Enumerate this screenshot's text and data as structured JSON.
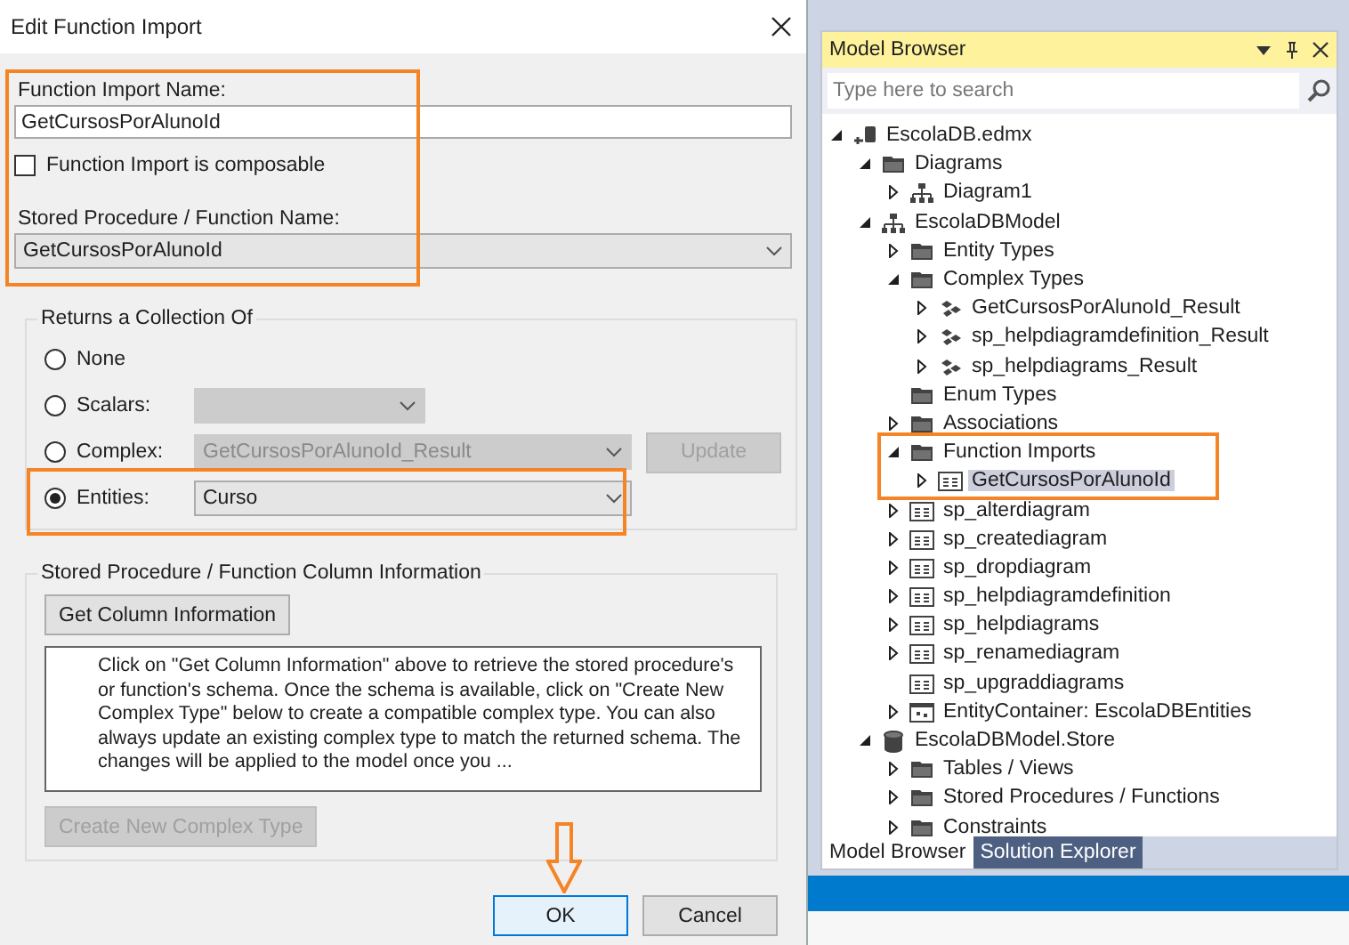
{
  "dialog": {
    "title": "Edit Function Import",
    "name_section": {
      "callout": true,
      "name_label": "Function Import Name:",
      "name_value": "GetCursosPorAlunoId",
      "composable": {
        "label": "Function Import is composable",
        "checked": false
      },
      "procedure_label": "Stored Procedure / Function Name:",
      "procedure_value": "GetCursosPorAlunoId"
    },
    "returns_group": {
      "title": "Returns a Collection Of",
      "options": [
        {
          "label": "None",
          "selected": false
        },
        {
          "label": "Scalars:",
          "selected": false,
          "dropdown": {
            "disabled": true
          }
        },
        {
          "label": "Complex:",
          "selected": false,
          "dropdown": {
            "value": "GetCursosPorAlunoId_Result",
            "disabled": true
          },
          "button": {
            "label": "Update",
            "disabled": true
          }
        },
        {
          "label": "Entities:",
          "selected": true,
          "callout": true,
          "dropdown": {
            "value": "Curso",
            "disabled": false
          }
        }
      ]
    },
    "column_group": {
      "title": "Stored Procedure / Function Column Information",
      "get_button": "Get Column Information",
      "info_text": "Click on \"Get Column Information\" above to retrieve the stored procedure's or function's schema. Once the schema is available, click on \"Create New Complex Type\" below to create a compatible complex type. You can also always update an existing complex type to match the returned schema. The changes will be applied to the model once you ...",
      "create_button": {
        "label": "Create New Complex Type",
        "disabled": true
      }
    },
    "buttons": [
      {
        "label": "OK",
        "pointed": true
      },
      {
        "label": "Cancel",
        "pointed": false
      }
    ]
  },
  "model_browser": {
    "title": "Model Browser",
    "search": {
      "placeholder": "Type here to search"
    },
    "tree": [
      {
        "label": "EscolaDB.edmx",
        "kind": "edmx",
        "expanded": true,
        "selected": false,
        "children": [
          {
            "label": "Diagrams",
            "kind": "folder",
            "expanded": true,
            "selected": false,
            "children": [
              {
                "label": "Diagram1",
                "kind": "diagram",
                "expanded": false,
                "selected": false
              }
            ]
          },
          {
            "label": "EscolaDBModel",
            "kind": "diagram",
            "expanded": true,
            "selected": false,
            "children": [
              {
                "label": "Entity Types",
                "kind": "folder",
                "expanded": false,
                "selected": false
              },
              {
                "label": "Complex Types",
                "kind": "folder",
                "expanded": true,
                "selected": false,
                "children": [
                  {
                    "label": "GetCursosPorAlunoId_Result",
                    "kind": "complex",
                    "expanded": false,
                    "selected": false
                  },
                  {
                    "label": "sp_helpdiagramdefinition_Result",
                    "kind": "complex",
                    "expanded": false,
                    "selected": false
                  },
                  {
                    "label": "sp_helpdiagrams_Result",
                    "kind": "complex",
                    "expanded": false,
                    "selected": false
                  }
                ]
              },
              {
                "label": "Enum Types",
                "kind": "folder",
                "selected": false
              },
              {
                "label": "Associations",
                "kind": "folder",
                "expanded": false,
                "selected": false
              },
              {
                "label": "Function Imports",
                "kind": "folder",
                "expanded": true,
                "selected": false,
                "callout": true,
                "children": [
                  {
                    "label": "GetCursosPorAlunoId",
                    "kind": "function",
                    "expanded": false,
                    "selected": true
                  }
                ]
              },
              {
                "label": "sp_alterdiagram",
                "kind": "function",
                "expanded": false,
                "selected": false
              },
              {
                "label": "sp_creatediagram",
                "kind": "function",
                "expanded": false,
                "selected": false
              },
              {
                "label": "sp_dropdiagram",
                "kind": "function",
                "expanded": false,
                "selected": false
              },
              {
                "label": "sp_helpdiagramdefinition",
                "kind": "function",
                "expanded": false,
                "selected": false
              },
              {
                "label": "sp_helpdiagrams",
                "kind": "function",
                "expanded": false,
                "selected": false
              },
              {
                "label": "sp_renamediagram",
                "kind": "function",
                "expanded": false,
                "selected": false
              },
              {
                "label": "sp_upgraddiagrams",
                "kind": "function",
                "selected": false
              },
              {
                "label": "EntityContainer: EscolaDBEntities",
                "kind": "container",
                "expanded": false,
                "selected": false
              }
            ]
          },
          {
            "label": "EscolaDBModel.Store",
            "kind": "database",
            "expanded": true,
            "selected": false,
            "children": [
              {
                "label": "Tables / Views",
                "kind": "folder",
                "expanded": false,
                "selected": false
              },
              {
                "label": "Stored Procedures / Functions",
                "kind": "folder",
                "expanded": false,
                "selected": false
              },
              {
                "label": "Constraints",
                "kind": "folder",
                "expanded": false,
                "selected": false
              }
            ]
          }
        ]
      }
    ],
    "tabs": [
      {
        "label": "Model Browser",
        "selected": true
      },
      {
        "label": "Solution Explorer",
        "selected": false
      }
    ]
  }
}
